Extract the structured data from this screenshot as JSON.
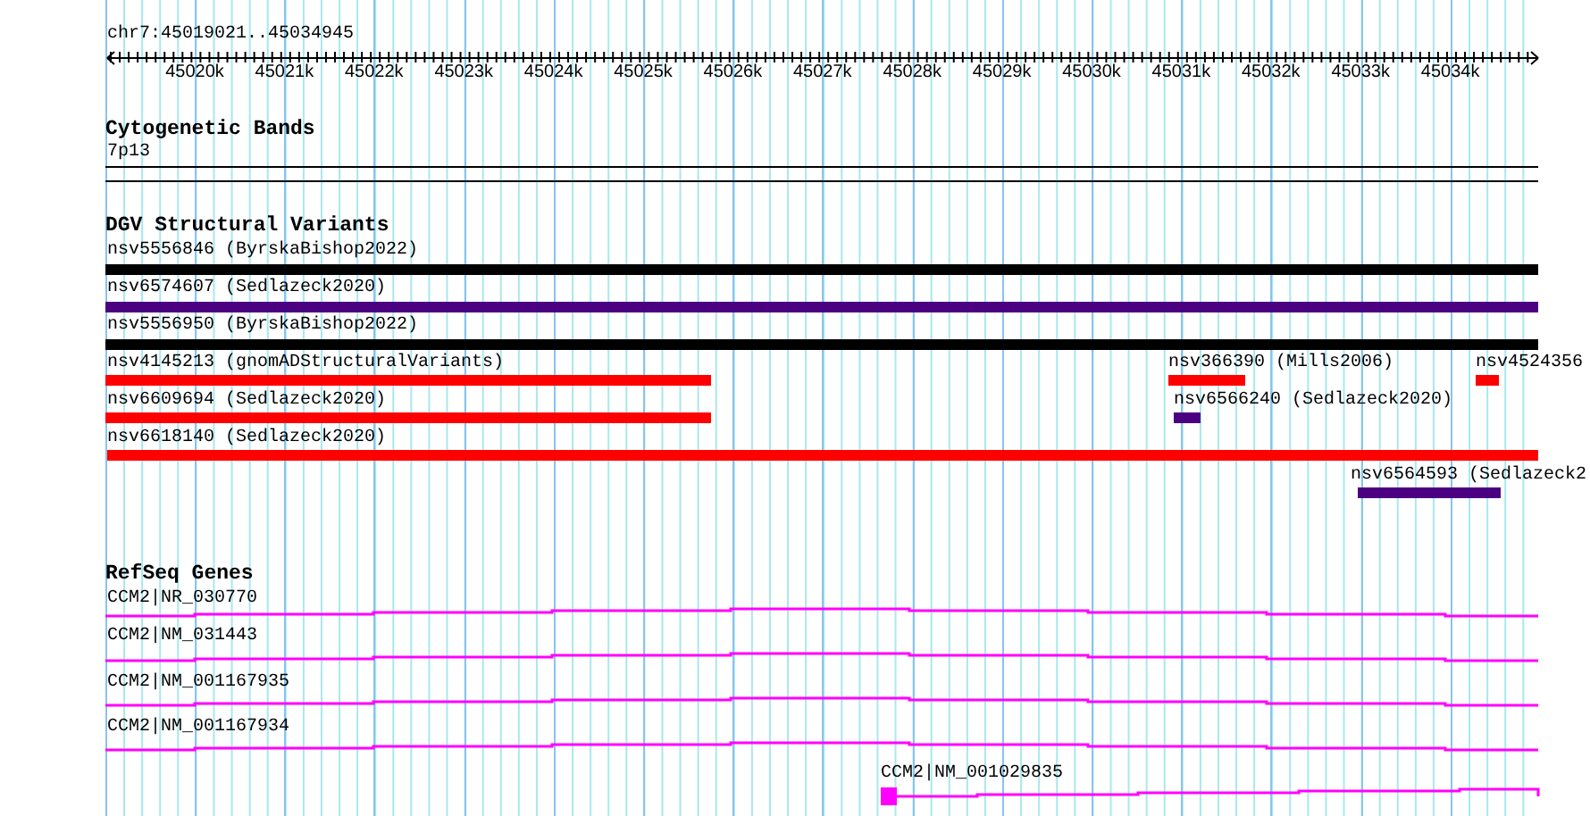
{
  "ruler": {
    "range": "chr7:45019021..45034945",
    "ticks": [
      "45020k",
      "45021k",
      "45022k",
      "45023k",
      "45024k",
      "45025k",
      "45026k",
      "45027k",
      "45028k",
      "45029k",
      "45030k",
      "45031k",
      "45032k",
      "45033k",
      "45034k"
    ]
  },
  "tracks": [
    {
      "kind": "bands",
      "title": "Cytogenetic Bands",
      "features": [
        {
          "label": "7p13"
        }
      ]
    },
    {
      "kind": "variants",
      "title": "DGV Structural Variants",
      "features": [
        {
          "label": "nsv5556846 (ByrskaBishop2022)",
          "color": "#000000"
        },
        {
          "label": "nsv6574607 (Sedlazeck2020)",
          "color": "#4b0082"
        },
        {
          "label": "nsv5556950 (ByrskaBishop2022)",
          "color": "#000000"
        },
        {
          "label": "nsv4145213 (gnomADStructuralVariants)",
          "color": "#ff0000"
        },
        {
          "label": "nsv366390 (Mills2006)",
          "color": "#ff0000"
        },
        {
          "label": "nsv4524356",
          "color": "#ff0000"
        },
        {
          "label": "nsv6609694 (Sedlazeck2020)",
          "color": "#ff0000"
        },
        {
          "label": "nsv6566240 (Sedlazeck2020)",
          "color": "#4b0082"
        },
        {
          "label": "nsv6618140 (Sedlazeck2020)",
          "color": "#ff0000"
        },
        {
          "label": "nsv6564593 (Sedlazeck2",
          "color": "#4b0082"
        }
      ]
    },
    {
      "kind": "genes",
      "title": "RefSeq Genes",
      "features": [
        {
          "label": "CCM2|NR_030770"
        },
        {
          "label": "CCM2|NM_031443"
        },
        {
          "label": "CCM2|NM_001167935"
        },
        {
          "label": "CCM2|NM_001167934"
        },
        {
          "label": "CCM2|NM_001029835"
        }
      ]
    }
  ]
}
